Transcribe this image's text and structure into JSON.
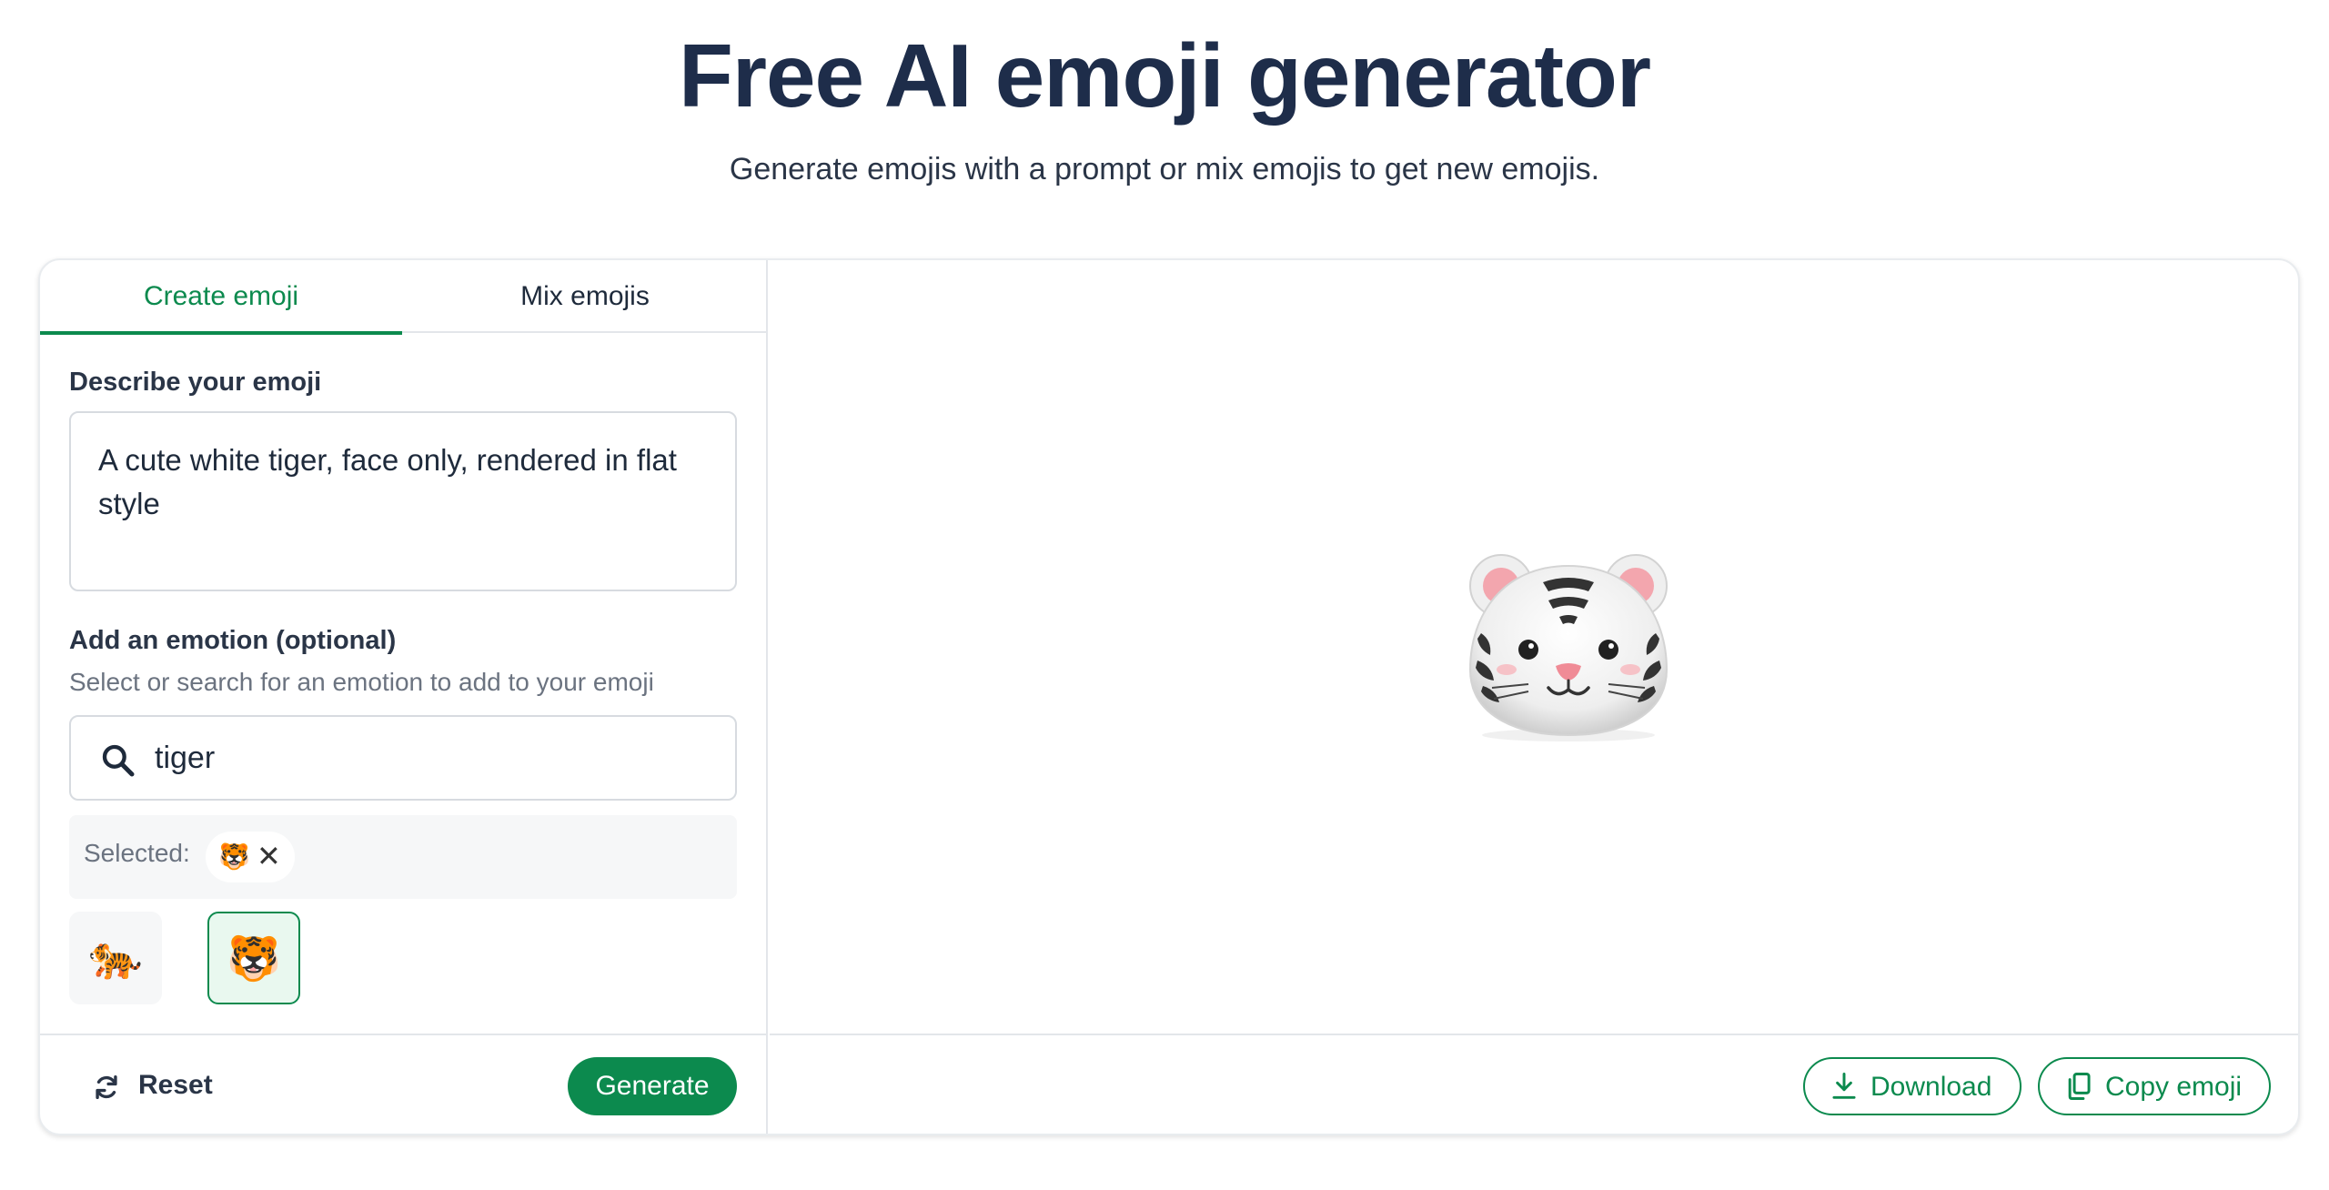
{
  "header": {
    "title": "Free AI emoji generator",
    "subtitle": "Generate emojis with a prompt or mix emojis to get new emojis."
  },
  "tabs": [
    {
      "label": "Create emoji",
      "active": true
    },
    {
      "label": "Mix emojis",
      "active": false
    }
  ],
  "describe": {
    "label": "Describe your emoji",
    "value": "A cute white tiger, face only, rendered in flat style"
  },
  "emotion": {
    "label": "Add an emotion (optional)",
    "hint": "Select or search for an emotion to add to your emoji",
    "search_value": "tiger",
    "selected_label": "Selected:",
    "selected_emoji": "🐯",
    "remove_glyph": "✕",
    "options": [
      "🐅",
      "🐯"
    ],
    "selected_index": 1
  },
  "footer": {
    "reset_label": "Reset",
    "generate_label": "Generate",
    "download_label": "Download",
    "copy_label": "Copy emoji"
  },
  "colors": {
    "accent": "#0c8a4e",
    "title": "#1e2d4a"
  },
  "icons": [
    "search-icon",
    "refresh-icon",
    "download-icon",
    "copy-icon",
    "close-icon"
  ]
}
